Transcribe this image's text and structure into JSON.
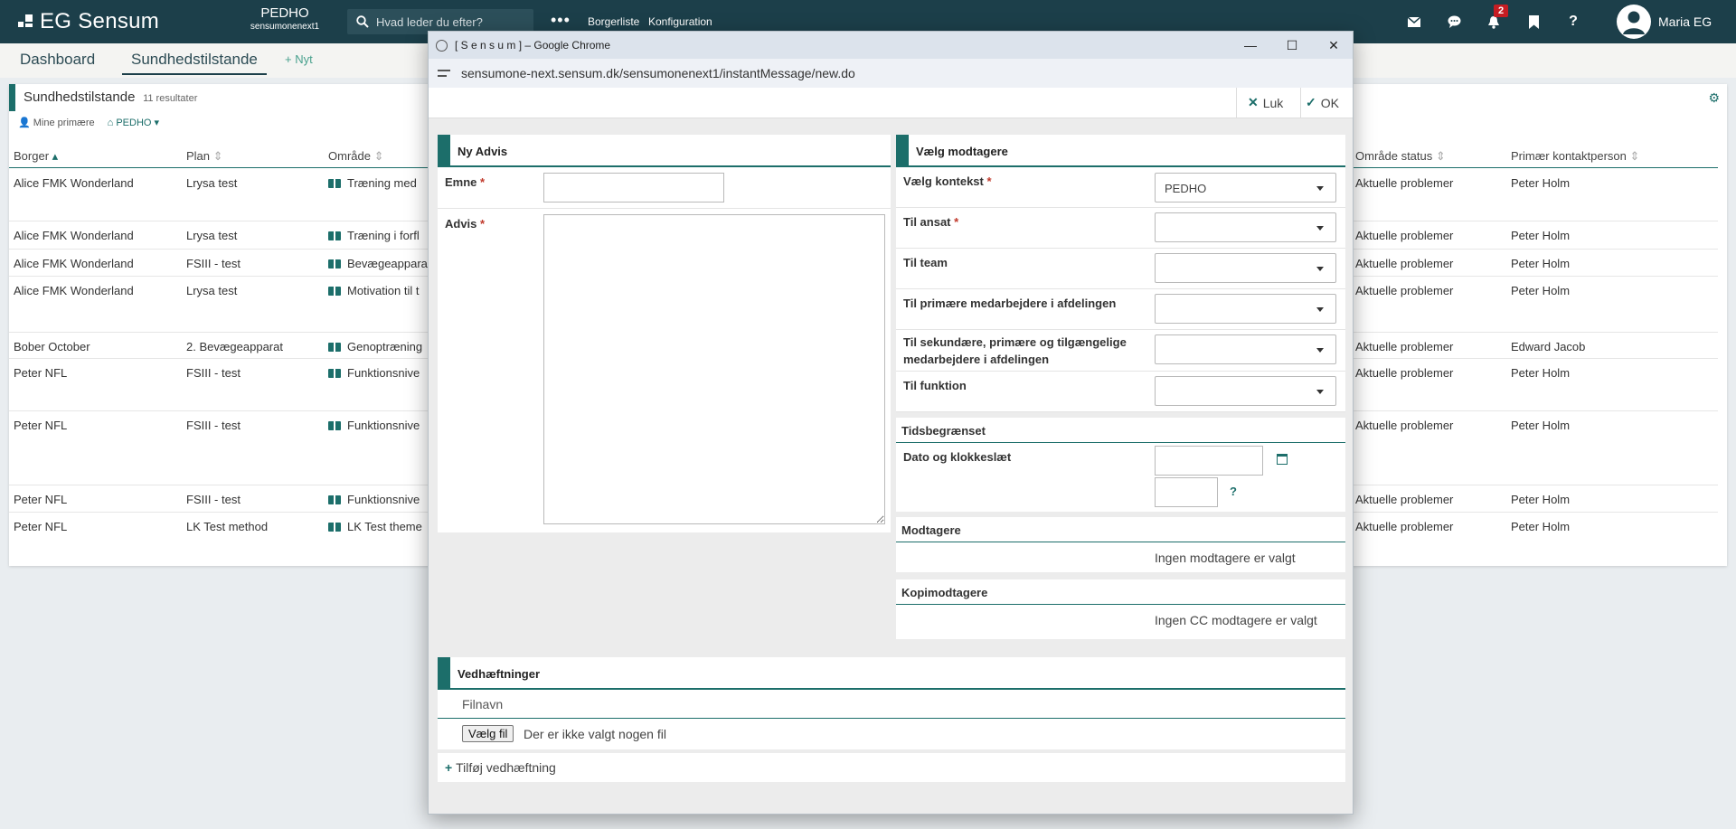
{
  "header": {
    "logo": "EG Sensum",
    "org_name": "PEDHO",
    "org_sub": "sensumonenext1",
    "search_placeholder": "Hvad leder du efter?",
    "more": "•••",
    "links": [
      "Borgerliste",
      "Konfiguration"
    ],
    "notification_count": "2",
    "help": "?",
    "user_name": "Maria EG"
  },
  "tabs": {
    "dashboard": "Dashboard",
    "health": "Sundhedstilstande",
    "new": "+ Nyt"
  },
  "list": {
    "title": "Sundhedstilstande",
    "count": "11 resultater",
    "filter_primary": "Mine primære",
    "filter_org": "PEDHO",
    "columns": {
      "borger": "Borger",
      "plan": "Plan",
      "omraade": "Område",
      "status": "Område status",
      "contact": "Primær kontaktperson"
    },
    "rows": [
      {
        "borger": "Alice FMK Wonderland",
        "plan": "Lrysa test",
        "omraade": "Træning med",
        "status": "Aktuelle problemer",
        "contact": "Peter Holm"
      },
      {
        "borger": "Alice FMK Wonderland",
        "plan": "Lrysa test",
        "omraade": "Træning i forfl",
        "status": "Aktuelle problemer",
        "contact": "Peter Holm"
      },
      {
        "borger": "Alice FMK Wonderland",
        "plan": "FSIII - test",
        "omraade": "Bevægeappara",
        "status": "Aktuelle problemer",
        "contact": "Peter Holm"
      },
      {
        "borger": "Alice FMK Wonderland",
        "plan": "Lrysa test",
        "omraade": "Motivation til t",
        "status": "Aktuelle problemer",
        "contact": "Peter Holm"
      },
      {
        "borger": "Bober October",
        "plan": "2. Bevægeapparat",
        "omraade": "Genoptræning",
        "status": "Aktuelle problemer",
        "contact": "Edward Jacob"
      },
      {
        "borger": "Peter NFL",
        "plan": "FSIII - test",
        "omraade": "Funktionsnive",
        "status": "Aktuelle problemer",
        "contact": "Peter Holm"
      },
      {
        "borger": "Peter NFL",
        "plan": "FSIII - test",
        "omraade": "Funktionsnive",
        "status": "Aktuelle problemer",
        "contact": "Peter Holm"
      },
      {
        "borger": "Peter NFL",
        "plan": "FSIII - test",
        "omraade": "Funktionsnive",
        "status": "Aktuelle problemer",
        "contact": "Peter Holm"
      },
      {
        "borger": "Peter NFL",
        "plan": "LK Test method",
        "omraade": "LK Test theme",
        "status": "Aktuelle problemer",
        "contact": "Peter Holm"
      }
    ]
  },
  "popup": {
    "window_title": "[ S e n s u m ] – Google Chrome",
    "url": "sensumone-next.sensum.dk/sensumonenext1/instantMessage/new.do",
    "close_label": "Luk",
    "ok_label": "OK",
    "advis": {
      "title": "Ny Advis",
      "subject_label": "Emne",
      "body_label": "Advis",
      "subject_value": "",
      "body_value": ""
    },
    "recipients": {
      "title": "Vælg modtagere",
      "context_label": "Vælg kontekst",
      "context_value": "PEDHO",
      "employee_label": "Til ansat",
      "team_label": "Til team",
      "primary_label": "Til primære medarbejdere i afdelingen",
      "secondary_label": "Til sekundære, primære og tilgængelige medarbejdere i afdelingen",
      "function_label": "Til funktion",
      "time_title": "Tidsbegrænset",
      "datetime_label": "Dato og klokkeslæt",
      "help": "?",
      "recipients_title": "Modtagere",
      "recipients_empty": "Ingen modtagere er valgt",
      "cc_title": "Kopimodtagere",
      "cc_empty": "Ingen CC modtagere er valgt"
    },
    "attachments": {
      "title": "Vedhæftninger",
      "filename_header": "Filnavn",
      "choose_file": "Vælg fil",
      "no_file": "Der er ikke valgt nogen fil",
      "add": "Tilføj vedhæftning"
    }
  }
}
